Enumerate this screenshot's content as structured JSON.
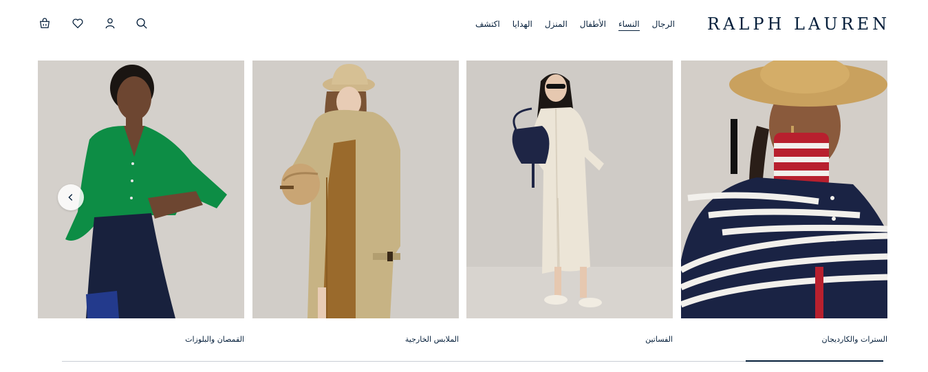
{
  "brand": {
    "logo_text": "RALPH LAUREN"
  },
  "nav": {
    "items": [
      {
        "label": "الرجال",
        "active": false
      },
      {
        "label": "النساء",
        "active": true
      },
      {
        "label": "الأطفال",
        "active": false
      },
      {
        "label": "المنزل",
        "active": false
      },
      {
        "label": "الهدايا",
        "active": false
      },
      {
        "label": "اكتشف",
        "active": false
      }
    ]
  },
  "header_icons": [
    "search-icon",
    "account-icon",
    "wishlist-heart-icon",
    "shopping-bag-icon"
  ],
  "carousel": {
    "tiles": [
      {
        "caption": "السترات والكارديجان",
        "image": "model-striped-sweater-straw-hat"
      },
      {
        "caption": "الفساتين",
        "image": "model-cream-shirt-dress-sunglasses"
      },
      {
        "caption": "الملابس الخارجية",
        "image": "model-trench-coat-bucket-hat"
      },
      {
        "caption": "القمصان والبلوزات",
        "image": "model-green-shirt-navy-skirt"
      }
    ],
    "prev_icon": "chevron-left-icon",
    "progress": 0.17
  },
  "colors": {
    "brand_navy": "#041e3a",
    "track": "#c8cdd4"
  }
}
